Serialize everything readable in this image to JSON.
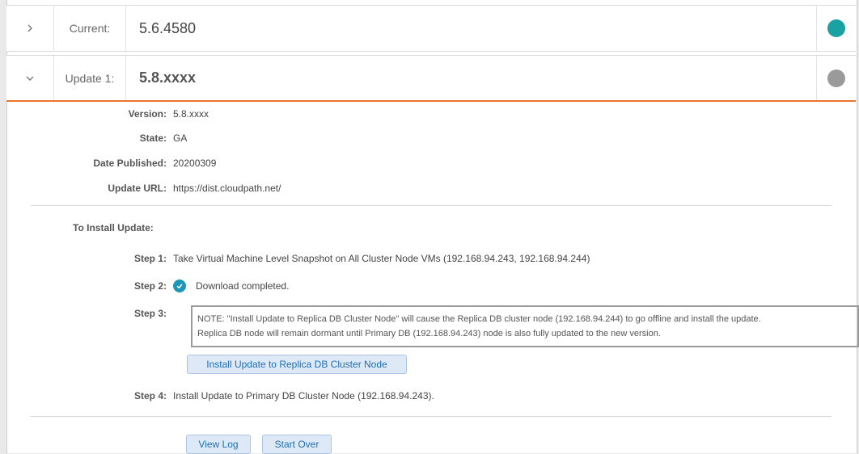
{
  "current": {
    "label": "Current:",
    "value": "5.6.4580",
    "status_color": "#1aa1a1"
  },
  "update": {
    "label": "Update 1:",
    "value": "5.8.xxxx",
    "status_color": "#9a9a9a",
    "accent": "#e8752a"
  },
  "details": {
    "version_label": "Version:",
    "version": "5.8.xxxx",
    "state_label": "State:",
    "state": "GA",
    "date_label": "Date Published:",
    "date": "20200309",
    "url_label": "Update URL:",
    "url": "https://dist.cloudpath.net/"
  },
  "install": {
    "title": "To Install Update:",
    "step1_label": "Step 1:",
    "step1_text": "Take Virtual Machine Level Snapshot on All Cluster Node VMs (192.168.94.243, 192.168.94.244)",
    "step2_label": "Step 2:",
    "step2_text": "Download completed.",
    "step3_label": "Step 3:",
    "note_line1": "NOTE: \"Install Update to Replica DB Cluster Node\" will cause the Replica DB cluster node (192.168.94.244) to go offline and install the update.",
    "note_line2": "Replica DB node will remain dormant until Primary DB (192.168.94.243) node is also fully updated to the new version.",
    "replica_button": "Install Update to Replica DB Cluster Node",
    "step4_label": "Step 4:",
    "step4_text": "Install Update to Primary DB Cluster Node (192.168.94.243)."
  },
  "actions": {
    "view_log": "View Log",
    "start_over": "Start Over"
  },
  "icons": {
    "collapsed": "chevron-right-icon",
    "expanded": "chevron-down-icon",
    "done": "check-circle-icon"
  }
}
